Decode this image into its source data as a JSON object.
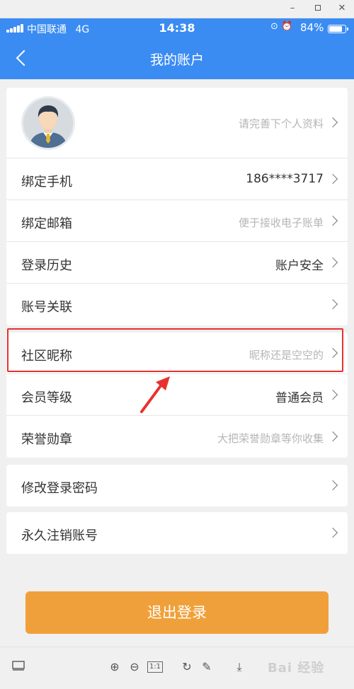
{
  "window": {
    "minimize_glyph": "–",
    "close_glyph": "✕"
  },
  "status_bar": {
    "carrier": "中国联通",
    "network": "4G",
    "time": "14:38",
    "icons": "⊙ ⏰",
    "battery_percent": "84%",
    "battery_level": 0.84
  },
  "nav": {
    "title": "我的账户"
  },
  "profile": {
    "hint": "请完善下个人资料",
    "avatar_icon": "user-avatar-icon"
  },
  "account_rows": [
    {
      "label": "绑定手机",
      "value": "186****3717",
      "hint": false
    },
    {
      "label": "绑定邮箱",
      "value": "便于接收电子账单",
      "hint": true
    },
    {
      "label": "登录历史",
      "value": "账户安全",
      "hint": false
    },
    {
      "label": "账号关联",
      "value": "",
      "hint": false
    }
  ],
  "community_rows": [
    {
      "label": "社区昵称",
      "value": "昵称还是空空的",
      "hint": true
    },
    {
      "label": "会员等级",
      "value": "普通会员",
      "hint": false
    },
    {
      "label": "荣誉勋章",
      "value": "大把荣誉勋章等你收集",
      "hint": true
    }
  ],
  "password_row": {
    "label": "修改登录密码"
  },
  "cancel_row": {
    "label": "永久注销账号"
  },
  "logout_button": "退出登录",
  "toolbar": {
    "zoom_in": "⊕",
    "zoom_out": "⊖",
    "actual_size": "1:1",
    "rotate": "↻",
    "edit": "✎",
    "download": "⤓",
    "watermark": "Bai 经验"
  },
  "colors": {
    "header": "#3a8cf3",
    "logout": "#f0a03a",
    "highlight": "#e8312e"
  }
}
